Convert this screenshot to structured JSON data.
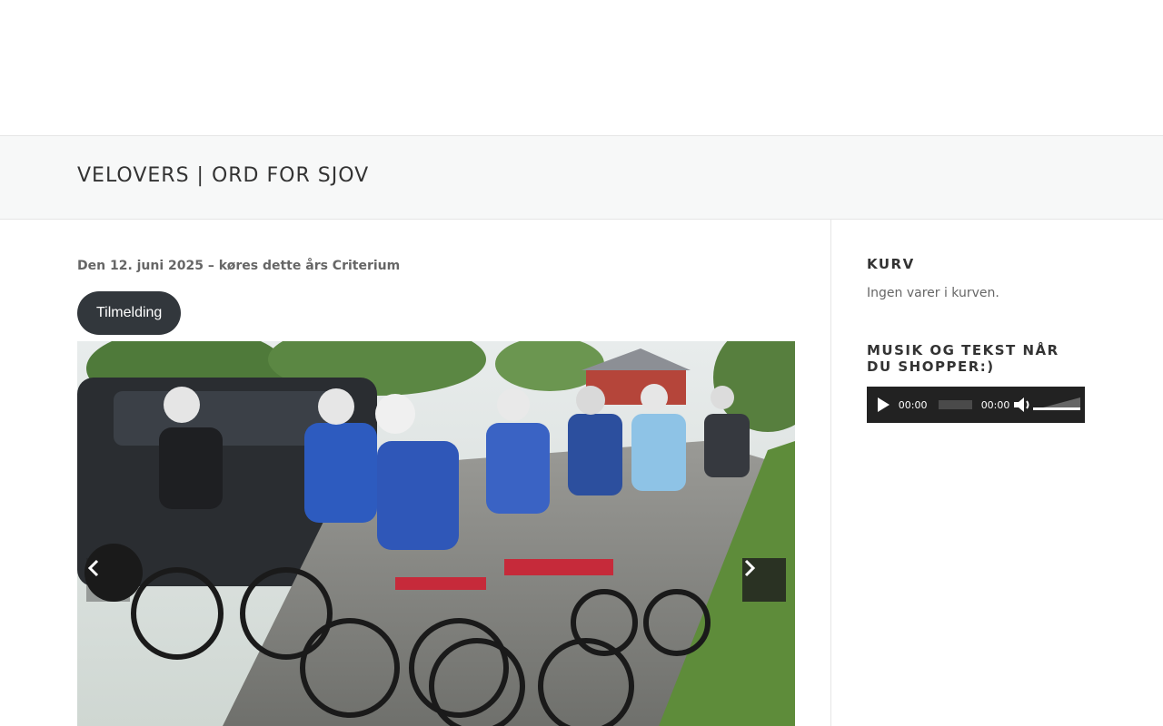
{
  "page": {
    "title": "VELOVERS | ORD FOR SJOV"
  },
  "main": {
    "intro": "Den 12. juni 2025 – køres dette års Criterium",
    "signup_button": "Tilmelding",
    "slider": {
      "prev_icon": "chevron-left-icon",
      "next_icon": "chevron-right-icon"
    }
  },
  "sidebar": {
    "cart": {
      "title": "KURV",
      "empty_text": "Ingen varer i kurven."
    },
    "music": {
      "title": "MUSIK OG TEKST NÅR DU SHOPPER:)",
      "player": {
        "current_time": "00:00",
        "duration": "00:00",
        "play_icon": "play-icon",
        "mute_icon": "speaker-icon"
      }
    }
  },
  "colors": {
    "button_bg": "#32373c",
    "title_bar_bg": "#f7f8f8",
    "player_bg": "#222222"
  }
}
